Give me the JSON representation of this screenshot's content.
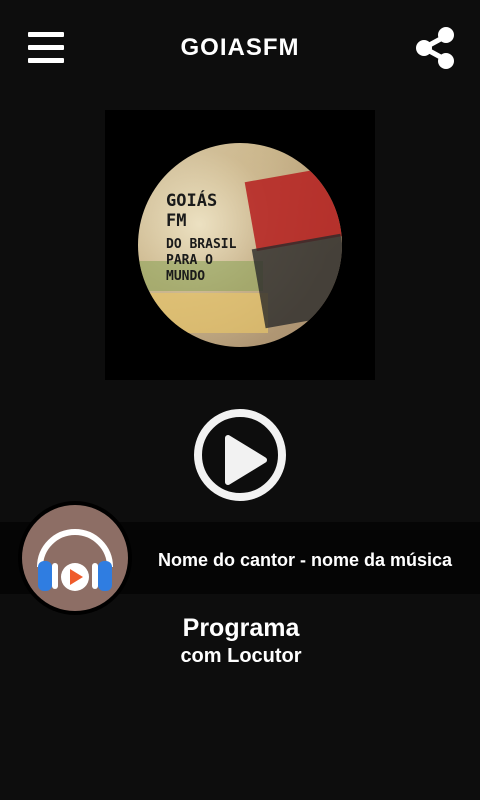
{
  "header": {
    "title": "GOIASFM",
    "menu_icon": "hamburger-menu-icon",
    "share_icon": "share-icon"
  },
  "cover": {
    "line1": "GOIÁS",
    "line2": "FM",
    "line3": "DO BRASIL",
    "line4": "PARA O",
    "line5": "MUNDO"
  },
  "player": {
    "play_icon": "play-icon",
    "song": "Nome do cantor - nome da música",
    "avatar_icon": "headphones-play-icon"
  },
  "program": {
    "title": "Programa",
    "subtitle": "com Locutor"
  },
  "colors": {
    "background": "#0d0d0d",
    "now_bar": "#050505",
    "avatar_bg": "#8d6e65",
    "accent_blue": "#2f7de1",
    "accent_orange": "#ef5b2b"
  }
}
